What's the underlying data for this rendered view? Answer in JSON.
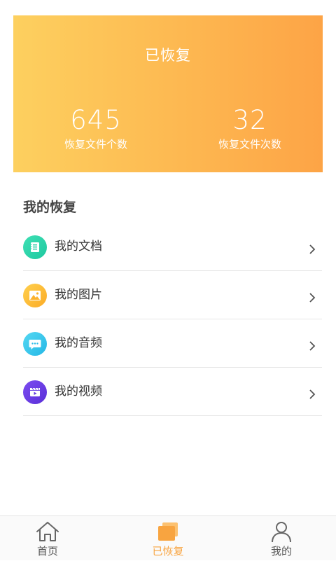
{
  "banner": {
    "title": "已恢复",
    "stats": [
      {
        "value": "645",
        "label": "恢复文件个数"
      },
      {
        "value": "32",
        "label": "恢复文件次数"
      }
    ]
  },
  "section": {
    "title": "我的恢复",
    "items": [
      {
        "label": "我的文档",
        "icon": "document-icon"
      },
      {
        "label": "我的图片",
        "icon": "image-icon"
      },
      {
        "label": "我的音频",
        "icon": "message-icon"
      },
      {
        "label": "我的视频",
        "icon": "video-icon"
      }
    ]
  },
  "tabbar": {
    "tabs": [
      {
        "label": "首页",
        "icon": "home-icon"
      },
      {
        "label": "已恢复",
        "icon": "stack-icon",
        "active": true
      },
      {
        "label": "我的",
        "icon": "user-icon"
      }
    ]
  },
  "colors": {
    "banner_start": "#fdd05f",
    "banner_end": "#fda446",
    "active_tab": "#f8a440",
    "inactive_tab": "#555555"
  }
}
